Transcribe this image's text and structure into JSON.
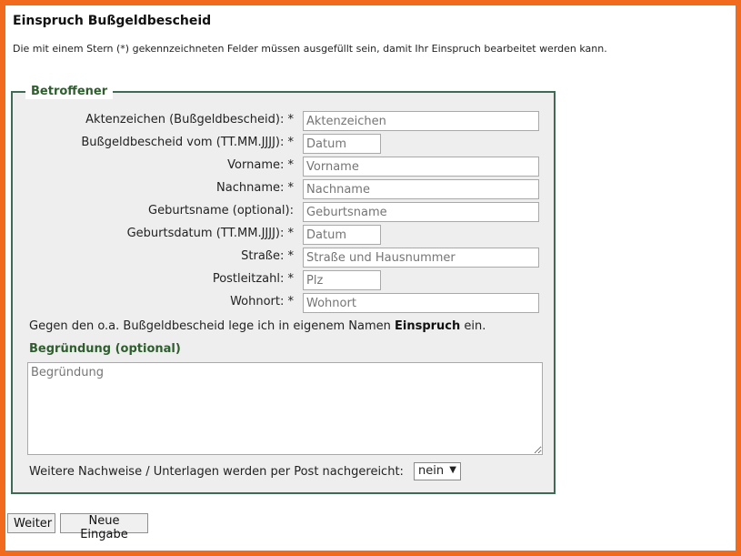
{
  "page": {
    "title": "Einspruch Bußgeldbescheid",
    "intro": "Die mit einem Stern (*) gekennzeichneten Felder müssen ausgefüllt sein, damit Ihr Einspruch bearbeitet werden kann."
  },
  "fieldset": {
    "legend": "Betroffener",
    "fields": [
      {
        "label": "Aktenzeichen (Bußgeldbescheid): *",
        "placeholder": "Aktenzeichen"
      },
      {
        "label": "Bußgeldbescheid vom (TT.MM.JJJJ): *",
        "placeholder": "Datum"
      },
      {
        "label": "Vorname: *",
        "placeholder": "Vorname"
      },
      {
        "label": "Nachname: *",
        "placeholder": "Nachname"
      },
      {
        "label": "Geburtsname (optional):",
        "placeholder": "Geburtsname"
      },
      {
        "label": "Geburtsdatum (TT.MM.JJJJ): *",
        "placeholder": "Datum"
      },
      {
        "label": "Straße: *",
        "placeholder": "Straße und Hausnummer"
      },
      {
        "label": "Postleitzahl: *",
        "placeholder": "Plz"
      },
      {
        "label": "Wohnort: *",
        "placeholder": "Wohnort"
      }
    ],
    "statement_before": "Gegen den o.a. Bußgeldbescheid lege ich in eigenem Namen ",
    "statement_bold": "Einspruch",
    "statement_after": " ein.",
    "reason_heading": "Begründung (optional)",
    "reason_placeholder": "Begründung",
    "post_label": "Weitere Nachweise / Unterlagen werden per Post nachgereicht:",
    "post_value": "nein",
    "post_caret": "▼"
  },
  "buttons": {
    "next": "Weiter",
    "reset": "Neue Eingabe"
  },
  "colors": {
    "frame": "#f26b1d",
    "accent_green": "#2e5e2e",
    "fieldset_border": "#3f6b56",
    "fieldset_bg": "#eeeeee"
  }
}
